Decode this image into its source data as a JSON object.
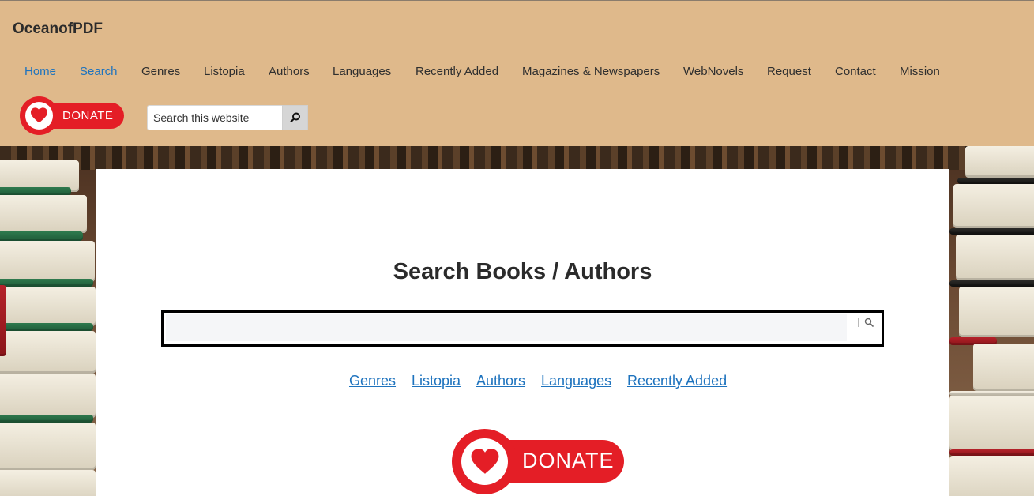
{
  "site": {
    "title": "OceanofPDF"
  },
  "nav": {
    "items": [
      {
        "label": "Home",
        "active": true
      },
      {
        "label": "Search",
        "active": true
      },
      {
        "label": "Genres"
      },
      {
        "label": "Listopia"
      },
      {
        "label": "Authors"
      },
      {
        "label": "Languages"
      },
      {
        "label": "Recently Added"
      },
      {
        "label": "Magazines & Newspapers"
      },
      {
        "label": "WebNovels"
      },
      {
        "label": "Request"
      },
      {
        "label": "Contact"
      },
      {
        "label": "Mission"
      }
    ]
  },
  "donate": {
    "label": "DONATE",
    "icon": "heart-icon"
  },
  "header_search": {
    "placeholder": "Search this website",
    "button_icon": "search-icon"
  },
  "main": {
    "heading": "Search Books / Authors",
    "search": {
      "value": "",
      "button_icon": "search-icon"
    },
    "links": [
      "Genres",
      "Listopia",
      "Authors",
      "Languages",
      "Recently Added"
    ]
  },
  "colors": {
    "header_bg": "#dfb98b",
    "link": "#1e73be",
    "donate_red": "#e41e26",
    "card_bg": "#ffffff"
  }
}
